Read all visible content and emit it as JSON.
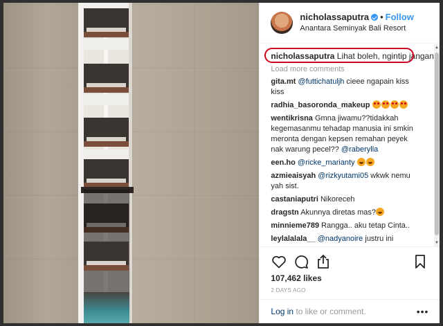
{
  "header": {
    "username": "nicholassaputra",
    "dot": "•",
    "follow_label": "Follow",
    "location": "Anantara Seminyak Bali Resort"
  },
  "caption": {
    "username": "nicholassaputra",
    "text": "Lihat boleh, ngintip jangan"
  },
  "load_more_label": "Load more comments",
  "comments": [
    {
      "user": "gita.mt",
      "mention": "@futtichatuljh",
      "text": " cieee ngapain kiss kiss"
    },
    {
      "user": "radhia_basoronda_makeup",
      "mention": "",
      "text": ""
    },
    {
      "user": "wentikrisna",
      "mention": "@raberylla",
      "text": "Gmna jiwamu??tidakkah kegemasanmu tehadap manusia ini smkin meronta dengan kepsen remahan peyek nak warung pecel?? "
    },
    {
      "user": "een.ho",
      "mention": "@ricke_marianty",
      "text": ""
    },
    {
      "user": "azmieaisyah",
      "mention": "@rizkyutami05",
      "text": " wkwk nemu yah sist."
    },
    {
      "user": "castaniaputri",
      "mention": "",
      "text": "Nikoreceh"
    },
    {
      "user": "dragstn",
      "mention": "",
      "text": "Akunnya diretas mas?"
    },
    {
      "user": "minnieme789",
      "mention": "",
      "text": "Rangga.. aku tetap Cinta.."
    },
    {
      "user": "leylalalala__",
      "mention": "@nadyanoire",
      "text": " justru ini sangat prinsipil"
    }
  ],
  "likes": "107,462 likes",
  "time_ago": "2 DAYS AGO",
  "login": {
    "link": "Log in",
    "rest": " to like or comment."
  },
  "more_label": "•••",
  "icons": [
    "heart-icon",
    "comment-icon",
    "share-icon",
    "bookmark-icon"
  ],
  "colors": {
    "accent": "#3897f0",
    "highlight_circle": "#d0021b",
    "mention": "#003569"
  }
}
